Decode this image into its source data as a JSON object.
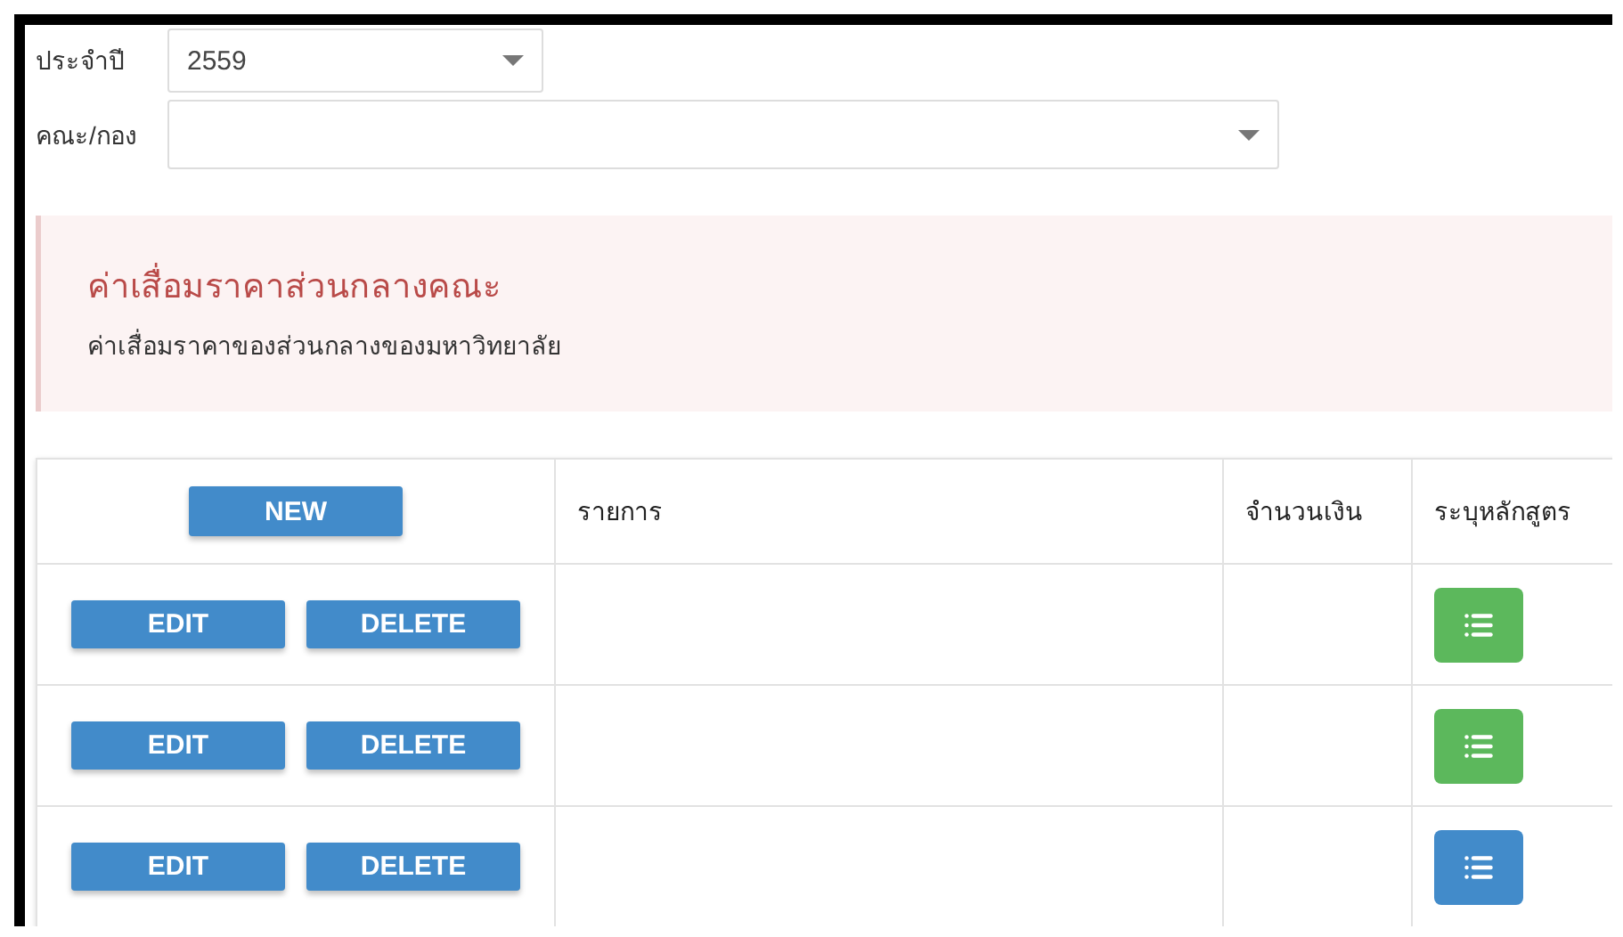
{
  "filters": [
    {
      "label": "ประจำปี",
      "value": "2559",
      "kind": "short"
    },
    {
      "label": "คณะ/กอง",
      "kind": "long"
    }
  ],
  "alert": {
    "title": "ค่าเสื่อมราคาส่วนกลางคณะ",
    "text": "ค่าเสื่อมราคาของส่วนกลางของมหาวิทยาลัย"
  },
  "table": {
    "new_button": "NEW",
    "columns": [
      "รายการ",
      "จำนวนเงิน",
      "ระบุหลักสูตร"
    ],
    "rows": [
      {
        "edit": "EDIT",
        "delete": "DELETE",
        "color": "#5cb85c"
      },
      {
        "edit": "EDIT",
        "delete": "DELETE",
        "color": "#5cb85c"
      },
      {
        "edit": "EDIT",
        "delete": "DELETE",
        "color": "#428bca"
      }
    ]
  }
}
